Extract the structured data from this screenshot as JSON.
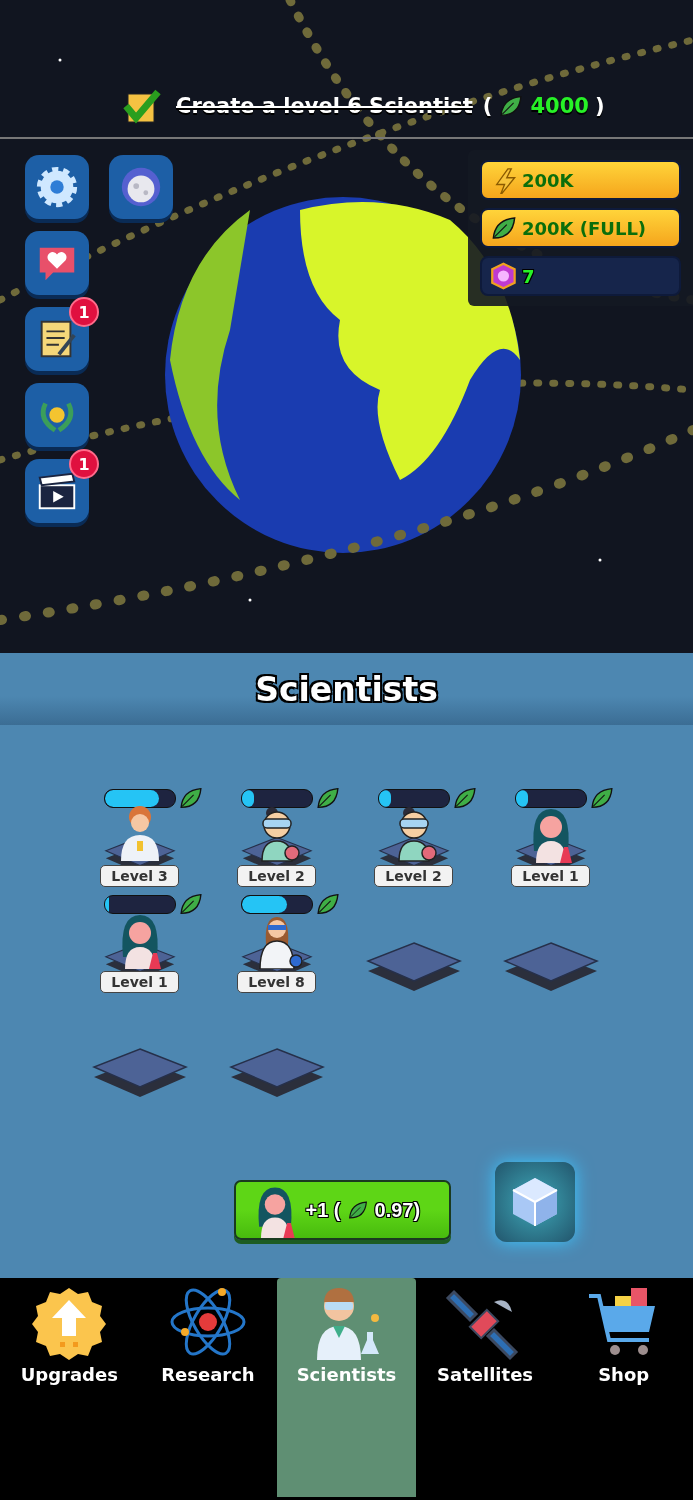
{
  "quest": {
    "completed": true,
    "text": "Create a level 6 Scientist",
    "open": "(",
    "reward": "4000",
    "close": ")"
  },
  "side_buttons": [
    {
      "kind": "settings"
    },
    {
      "kind": "moon"
    },
    {
      "kind": "heart"
    },
    {
      "kind": "notes",
      "badge": "1"
    },
    {
      "kind": "laurel"
    },
    {
      "kind": "video",
      "badge": "1"
    }
  ],
  "resources": [
    {
      "kind": "energy",
      "value": "200K"
    },
    {
      "kind": "leaf",
      "value": "200K (FULL)"
    },
    {
      "kind": "gem",
      "value": "7"
    }
  ],
  "panel": {
    "title": "Scientists"
  },
  "slots": [
    {
      "kind": "curly",
      "level": 0.78,
      "label": "Level 3"
    },
    {
      "kind": "goggles",
      "level": 0.18,
      "label": "Level 2"
    },
    {
      "kind": "goggles",
      "level": 0.18,
      "label": "Level 2"
    },
    {
      "kind": "longhair",
      "level": 0.18,
      "label": "Level 1"
    },
    {
      "kind": "longhair",
      "level": 0.07,
      "label": "Level 1"
    },
    {
      "kind": "labcoat",
      "level": 0.65,
      "label": "Level 8"
    },
    {
      "kind": "empty"
    },
    {
      "kind": "empty"
    },
    {
      "kind": "empty"
    },
    {
      "kind": "empty"
    }
  ],
  "buy": {
    "kind": "longhair",
    "prefix": "+1 (",
    "price": "0.97)"
  },
  "tabs": [
    {
      "kind": "upgrades",
      "label": "Upgrades",
      "selected": false
    },
    {
      "kind": "research",
      "label": "Research",
      "selected": false
    },
    {
      "kind": "scientists",
      "label": "Scientists",
      "selected": true
    },
    {
      "kind": "satellites",
      "label": "Satellites",
      "selected": false
    },
    {
      "kind": "shop",
      "label": "Shop",
      "selected": false
    }
  ]
}
